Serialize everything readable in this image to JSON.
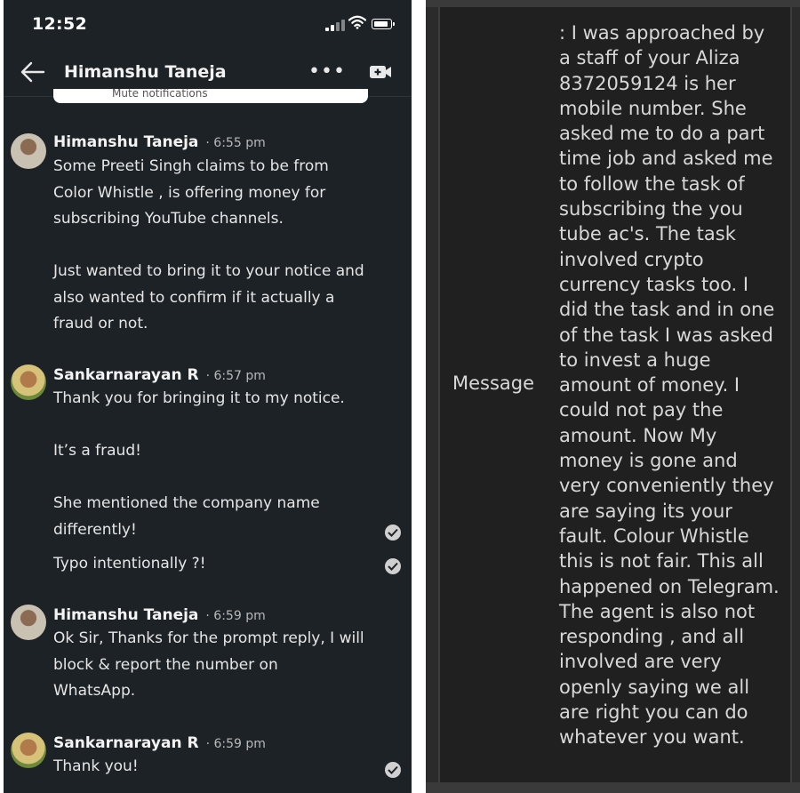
{
  "status_bar": {
    "time": "12:52"
  },
  "chat": {
    "title": "Himanshu Taneja",
    "more_label": "•••",
    "mute_banner": "Mute notifications",
    "groups": [
      {
        "sender": "Himanshu Taneja",
        "time": "· 6:55 pm",
        "messages": [
          "Some  Preeti Singh claims to be from\nColor Whistle , is offering money for\nsubscribing YouTube channels.\n\nJust wanted to bring it to your notice and\nalso wanted to confirm if it actually a\nfraud or not."
        ]
      },
      {
        "sender": "Sankarnarayan R",
        "time": "· 6:57 pm",
        "messages": [
          "Thank you for bringing it to my notice.\n\nIt’s a fraud!\n\nShe mentioned the company name\ndifferently!",
          "Typo intentionally ?!"
        ]
      },
      {
        "sender": "Himanshu Taneja",
        "time": "· 6:59 pm",
        "messages": [
          "Ok Sir, Thanks for the prompt reply, I will\nblock & report the number on\nWhatsApp."
        ]
      },
      {
        "sender": "Sankarnarayan R",
        "time": "· 6:59 pm",
        "messages": [
          "Thank you!"
        ]
      }
    ]
  },
  "form": {
    "label": "Message",
    "value": ": I was approached by\na staff of your Aliza\n8372059124 is her\nmobile number. She\nasked me to do a part\ntime job and asked me\nto follow the task of\nsubscribing the you\ntube ac's. The task\ninvolved crypto\ncurrency tasks too. I\ndid the task and in one\nof the task I was asked\nto invest a huge\namount of money. I\ncould not pay the\namount. Now My\nmoney is gone and\nvery conveniently they\nare saying its your\nfault. Colour Whistle\nthis is not fair. This all\nhappened on Telegram.\nThe agent is also not\nresponding , and all\ninvolved are very\nopenly saying we all\nare right you can do\nwhatever you want."
  }
}
